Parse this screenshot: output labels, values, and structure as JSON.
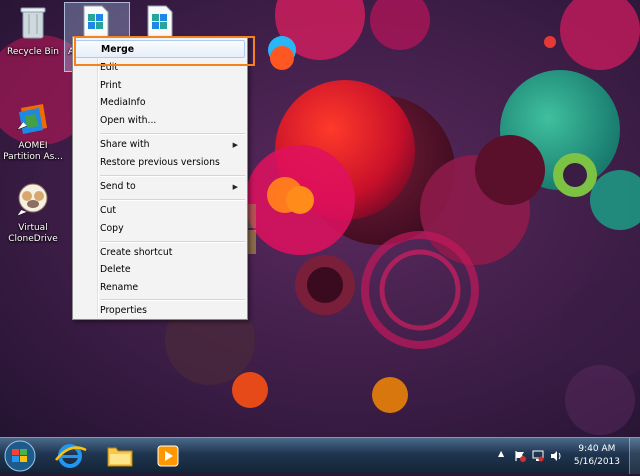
{
  "desktop": {
    "icons": [
      {
        "label": "Recycle Bin"
      },
      {
        "label": "AOMEI Partition As..."
      },
      {
        "label": "Virtual CloneDrive"
      },
      {
        "label": "A"
      }
    ]
  },
  "context_menu": {
    "items": [
      {
        "label": "Merge"
      },
      {
        "label": "Edit"
      },
      {
        "label": "Print"
      },
      {
        "label": "MediaInfo"
      },
      {
        "label": "Open with..."
      },
      {
        "label": "Share with"
      },
      {
        "label": "Restore previous versions"
      },
      {
        "label": "Send to"
      },
      {
        "label": "Cut"
      },
      {
        "label": "Copy"
      },
      {
        "label": "Create shortcut"
      },
      {
        "label": "Delete"
      },
      {
        "label": "Rename"
      },
      {
        "label": "Properties"
      }
    ]
  },
  "taskbar": {
    "clock": {
      "time": "9:40 AM",
      "date": "5/16/2013"
    },
    "tray": {
      "show_hidden": "▲"
    }
  },
  "colors": {
    "highlight": "#f4821f",
    "taskbar": "#1f3550"
  }
}
